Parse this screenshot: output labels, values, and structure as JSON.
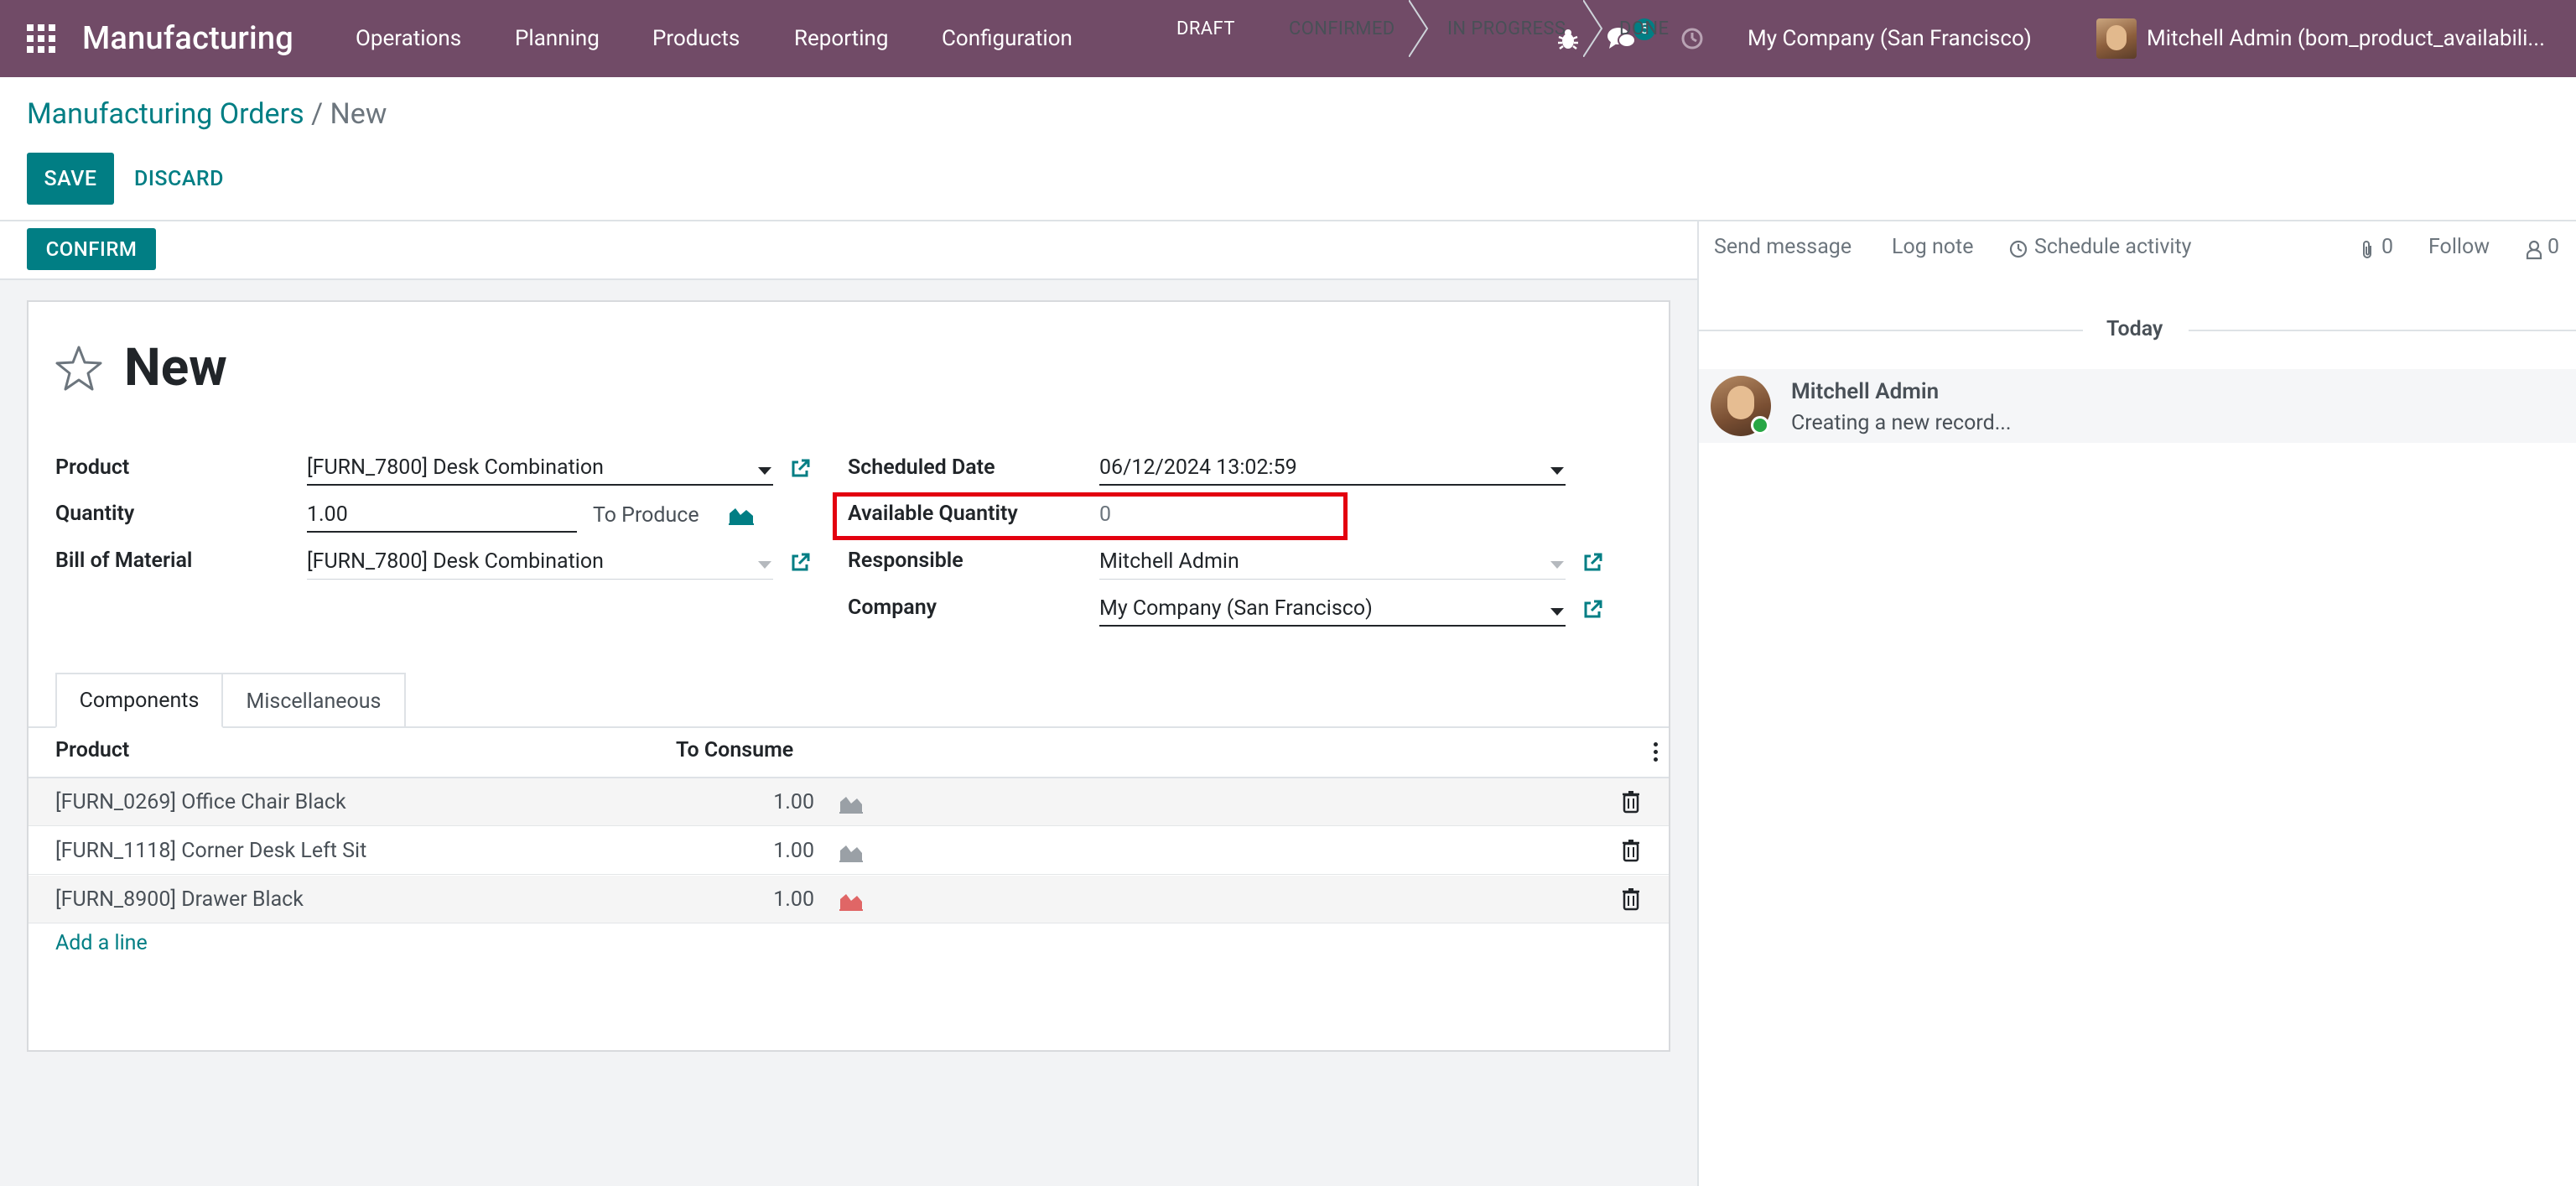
{
  "navbar": {
    "app_name": "Manufacturing",
    "menu": [
      "Operations",
      "Planning",
      "Products",
      "Reporting",
      "Configuration"
    ],
    "messages_count": "5",
    "company": "My Company (San Francisco)",
    "user": "Mitchell Admin (bom_product_availabili..."
  },
  "breadcrumb": {
    "parent": "Manufacturing Orders",
    "separator": "/",
    "current": "New"
  },
  "actions": {
    "save": "SAVE",
    "discard": "DISCARD",
    "confirm": "CONFIRM"
  },
  "status": {
    "stages": [
      "DRAFT",
      "CONFIRMED",
      "IN PROGRESS",
      "DONE"
    ],
    "active": "DRAFT"
  },
  "form": {
    "title": "New",
    "product_label": "Product",
    "product_value": "[FURN_7800] Desk Combination",
    "quantity_label": "Quantity",
    "quantity_value": "1.00",
    "to_produce": "To Produce",
    "bom_label": "Bill of Material",
    "bom_value": "[FURN_7800] Desk Combination",
    "scheduled_label": "Scheduled Date",
    "scheduled_value": "06/12/2024 13:02:59",
    "available_label": "Available Quantity",
    "available_value": "0",
    "responsible_label": "Responsible",
    "responsible_value": "Mitchell Admin",
    "company_label": "Company",
    "company_value": "My Company (San Francisco)"
  },
  "tabs": {
    "components": "Components",
    "misc": "Miscellaneous"
  },
  "list": {
    "headers": {
      "product": "Product",
      "to_consume": "To Consume"
    },
    "rows": [
      {
        "product": "[FURN_0269] Office Chair Black",
        "qty": "1.00",
        "forecast_color": "#9aa0a6"
      },
      {
        "product": "[FURN_1118] Corner Desk Left Sit",
        "qty": "1.00",
        "forecast_color": "#9aa0a6"
      },
      {
        "product": "[FURN_8900] Drawer Black",
        "qty": "1.00",
        "forecast_color": "#e06666"
      }
    ],
    "add_line": "Add a line"
  },
  "chatter": {
    "send_message": "Send message",
    "log_note": "Log note",
    "schedule_activity": "Schedule activity",
    "attachments": "0",
    "follow": "Follow",
    "followers": "0",
    "today": "Today",
    "message": {
      "author": "Mitchell Admin",
      "body": "Creating a new record..."
    }
  },
  "colors": {
    "brand": "#714B67",
    "accent": "#017E84",
    "highlight": "#e3000f"
  }
}
